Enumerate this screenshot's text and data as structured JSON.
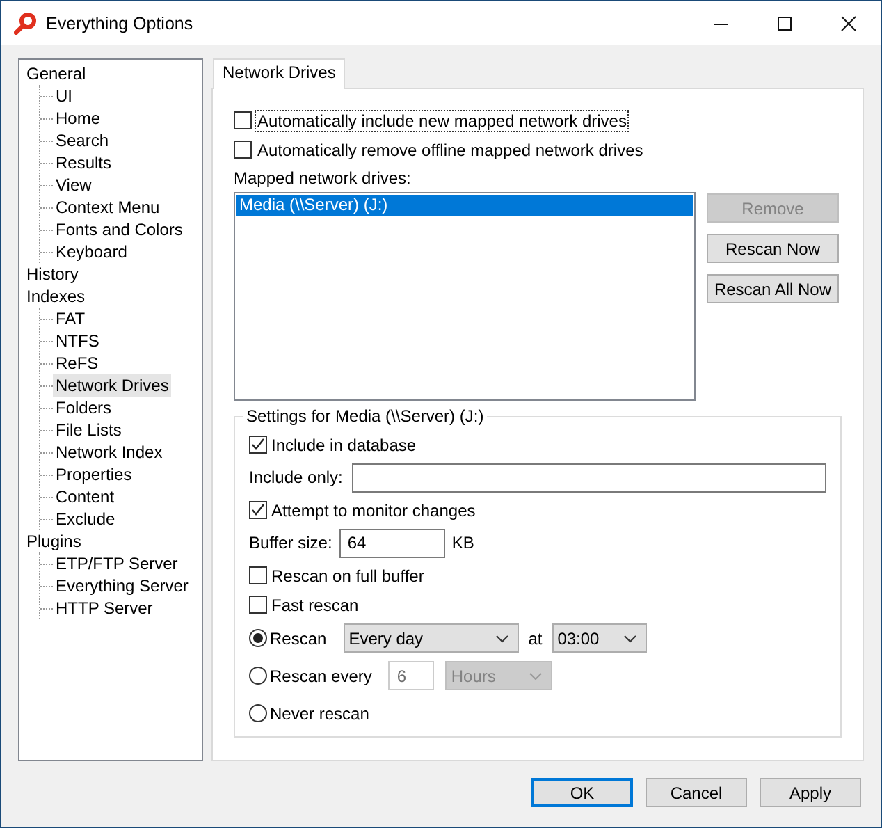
{
  "window": {
    "title": "Everything Options"
  },
  "tree": [
    {
      "label": "General",
      "selected": false,
      "children": [
        {
          "label": "UI",
          "selected": false
        },
        {
          "label": "Home",
          "selected": false
        },
        {
          "label": "Search",
          "selected": false
        },
        {
          "label": "Results",
          "selected": false
        },
        {
          "label": "View",
          "selected": false
        },
        {
          "label": "Context Menu",
          "selected": false
        },
        {
          "label": "Fonts and Colors",
          "selected": false
        },
        {
          "label": "Keyboard",
          "selected": false
        }
      ]
    },
    {
      "label": "History",
      "selected": false
    },
    {
      "label": "Indexes",
      "selected": false,
      "children": [
        {
          "label": "FAT",
          "selected": false
        },
        {
          "label": "NTFS",
          "selected": false
        },
        {
          "label": "ReFS",
          "selected": false
        },
        {
          "label": "Network Drives",
          "selected": true
        },
        {
          "label": "Folders",
          "selected": false
        },
        {
          "label": "File Lists",
          "selected": false
        },
        {
          "label": "Network Index",
          "selected": false
        },
        {
          "label": "Properties",
          "selected": false
        },
        {
          "label": "Content",
          "selected": false
        },
        {
          "label": "Exclude",
          "selected": false
        }
      ]
    },
    {
      "label": "Plugins",
      "selected": false,
      "children": [
        {
          "label": "ETP/FTP Server",
          "selected": false
        },
        {
          "label": "Everything Server",
          "selected": false
        },
        {
          "label": "HTTP Server",
          "selected": false
        }
      ]
    }
  ],
  "tabs": [
    {
      "label": "Network Drives",
      "selected": true
    }
  ],
  "options": [
    {
      "label": "Automatically include new mapped network drives",
      "checked": false,
      "focused": true
    },
    {
      "label": "Automatically remove offline mapped network drives",
      "checked": false,
      "focused": false
    }
  ],
  "list_label": "Mapped network drives:",
  "drives": [
    {
      "label": "Media (\\\\Server) (J:)",
      "selected": true
    }
  ],
  "side_buttons": [
    {
      "label": "Remove",
      "disabled": true
    },
    {
      "label": "Rescan Now",
      "disabled": false
    },
    {
      "label": "Rescan All Now",
      "disabled": false
    }
  ],
  "settings": {
    "title": "Settings for Media (\\\\Server) (J:)",
    "rows": [
      {
        "kind": "checkbox",
        "label": "Include in database",
        "checked": true
      },
      {
        "kind": "wide-field",
        "label": "Include only:"
      },
      {
        "kind": "checkbox",
        "label": "Attempt to monitor changes",
        "checked": true
      },
      {
        "kind": "number-field",
        "label": "Buffer size:",
        "value": "64",
        "unit": "KB"
      },
      {
        "kind": "checkbox",
        "label": "Rescan on full buffer",
        "checked": false
      },
      {
        "kind": "checkbox",
        "label": "Fast rescan",
        "checked": false
      },
      {
        "kind": "radio",
        "label": "Rescan",
        "selected": true,
        "controls": [
          {
            "kind": "period",
            "value": "Every day",
            "disabled": false
          },
          {
            "kind": "caption",
            "value": "at"
          },
          {
            "kind": "time",
            "value": "03:00",
            "disabled": false
          }
        ]
      },
      {
        "kind": "radio",
        "label": "Rescan every",
        "selected": false,
        "controls": [
          {
            "kind": "count",
            "value": "6",
            "disabled": true
          },
          {
            "kind": "unit",
            "value": "Hours",
            "disabled": true
          }
        ]
      },
      {
        "kind": "radio",
        "label": "Never rescan",
        "selected": false
      }
    ]
  },
  "buttons": [
    {
      "label": "OK",
      "default": true
    },
    {
      "label": "Cancel",
      "default": false
    },
    {
      "label": "Apply",
      "default": false
    }
  ]
}
